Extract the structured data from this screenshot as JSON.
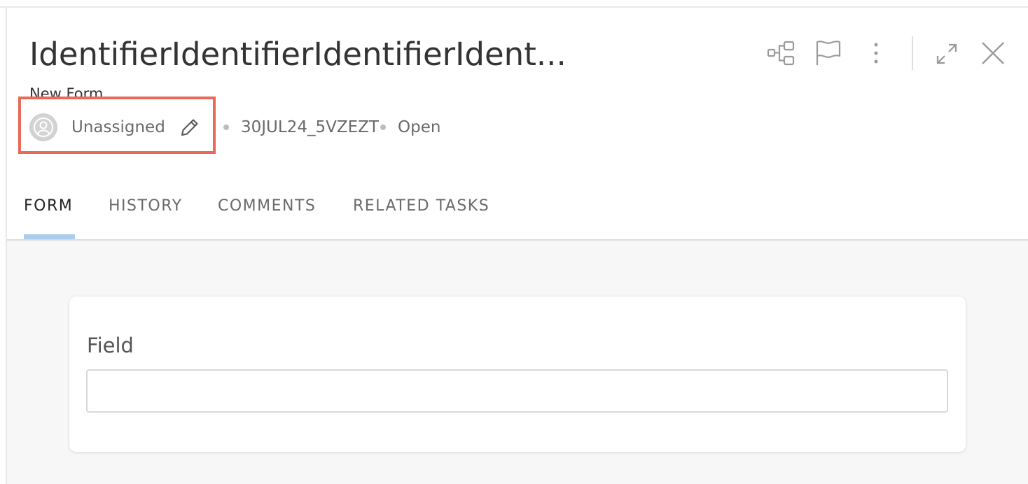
{
  "header": {
    "title": "IdentifierIdentifierIdentifierIdent...",
    "subtitle": "New Form",
    "assignee": "Unassigned",
    "task_id": "30JUL24_5VZEZT",
    "status": "Open"
  },
  "toolbar": {
    "icons": [
      "workflow-icon",
      "flag-icon",
      "more-vertical-icon",
      "expand-icon",
      "close-icon"
    ]
  },
  "tabs": [
    {
      "label": "FORM",
      "active": true
    },
    {
      "label": "HISTORY",
      "active": false
    },
    {
      "label": "COMMENTS",
      "active": false
    },
    {
      "label": "RELATED TASKS",
      "active": false
    }
  ],
  "form": {
    "field_label": "Field",
    "field_value": ""
  },
  "colors": {
    "highlight_border": "#e86a57",
    "tab_underline": "#a9cdec",
    "content_background": "#f7f7f7"
  }
}
